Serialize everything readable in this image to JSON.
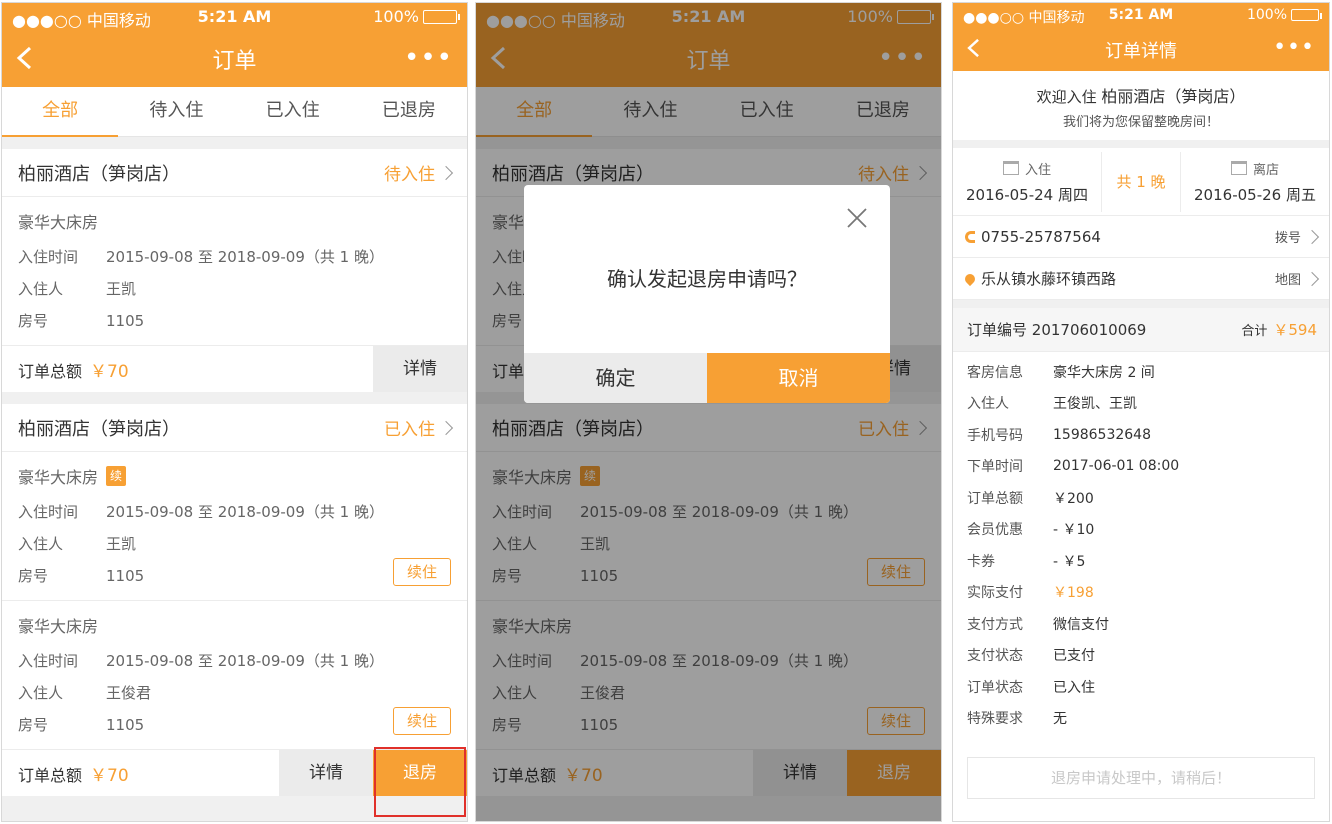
{
  "status_bar": {
    "carrier": "●●●○○ 中国移动",
    "time": "5:21 AM",
    "battery": "100%"
  },
  "list_screen": {
    "title": "订单",
    "tabs": [
      "全部",
      "待入住",
      "已入住",
      "已退房"
    ],
    "orders": [
      {
        "hotel": "柏丽酒店（笋岗店）",
        "status": "待入住",
        "rooms": [
          {
            "type": "豪华大床房",
            "checkin_label": "入住时间",
            "checkin": "2015-09-08 至 2018-09-09（共 1 晚）",
            "guest_label": "入住人",
            "guest": "王凯",
            "room_label": "房号",
            "room_no": "1105"
          }
        ],
        "total_label": "订单总额",
        "total": "￥70",
        "detail_btn": "详情"
      },
      {
        "hotel": "柏丽酒店（笋岗店）",
        "status": "已入住",
        "rooms": [
          {
            "type": "豪华大床房",
            "badge": "续",
            "checkin_label": "入住时间",
            "checkin": "2015-09-08 至 2018-09-09（共 1 晚）",
            "guest_label": "入住人",
            "guest": "王凯",
            "room_label": "房号",
            "room_no": "1105",
            "extend_btn": "续住"
          },
          {
            "type": "豪华大床房",
            "checkin_label": "入住时间",
            "checkin": "2015-09-08 至 2018-09-09（共 1 晚）",
            "guest_label": "入住人",
            "guest": "王俊君",
            "room_label": "房号",
            "room_no": "1105",
            "extend_btn": "续住"
          }
        ],
        "total_label": "订单总额",
        "total": "￥70",
        "detail_btn": "详情",
        "checkout_btn": "退房"
      }
    ]
  },
  "dialog": {
    "message": "确认发起退房申请吗？",
    "confirm": "确定",
    "cancel": "取消"
  },
  "detail_screen": {
    "title": "订单详情",
    "welcome_prefix": "欢迎入住",
    "hotel": "柏丽酒店（笋岗店）",
    "welcome_sub": "我们将为您保留整晚房间！",
    "checkin_label": "入住",
    "checkin_date": "2016-05-24 周四",
    "nights": "共 1 晚",
    "checkout_label": "离店",
    "checkout_date": "2016-05-26 周五",
    "phone": "0755-25787564",
    "dial": "拨号",
    "address": "乐从镇水藤环镇西路",
    "map": "地图",
    "order_no_label": "订单编号",
    "order_no": "201706010069",
    "sum_label": "合计",
    "sum": "￥594",
    "rows": [
      {
        "k": "客房信息",
        "v": "豪华大床房 2 间"
      },
      {
        "k": "入住人",
        "v": "王俊凯、王凯"
      },
      {
        "k": "手机号码",
        "v": "15986532648"
      },
      {
        "k": "下单时间",
        "v": "2017-06-01 08:00"
      },
      {
        "k": "订单总额",
        "v": "￥200"
      },
      {
        "k": "会员优惠",
        "v": "- ￥10"
      },
      {
        "k": "卡券",
        "v": "- ￥5"
      },
      {
        "k": "实际支付",
        "v": "￥198"
      },
      {
        "k": "支付方式",
        "v": "微信支付"
      },
      {
        "k": "支付状态",
        "v": "已支付"
      },
      {
        "k": "订单状态",
        "v": "已入住"
      },
      {
        "k": "特殊要求",
        "v": "无"
      }
    ],
    "pending": "退房申请处理中，请稍后！"
  },
  "colors": {
    "accent": "#f7a034",
    "highlight": "#e0302a"
  }
}
